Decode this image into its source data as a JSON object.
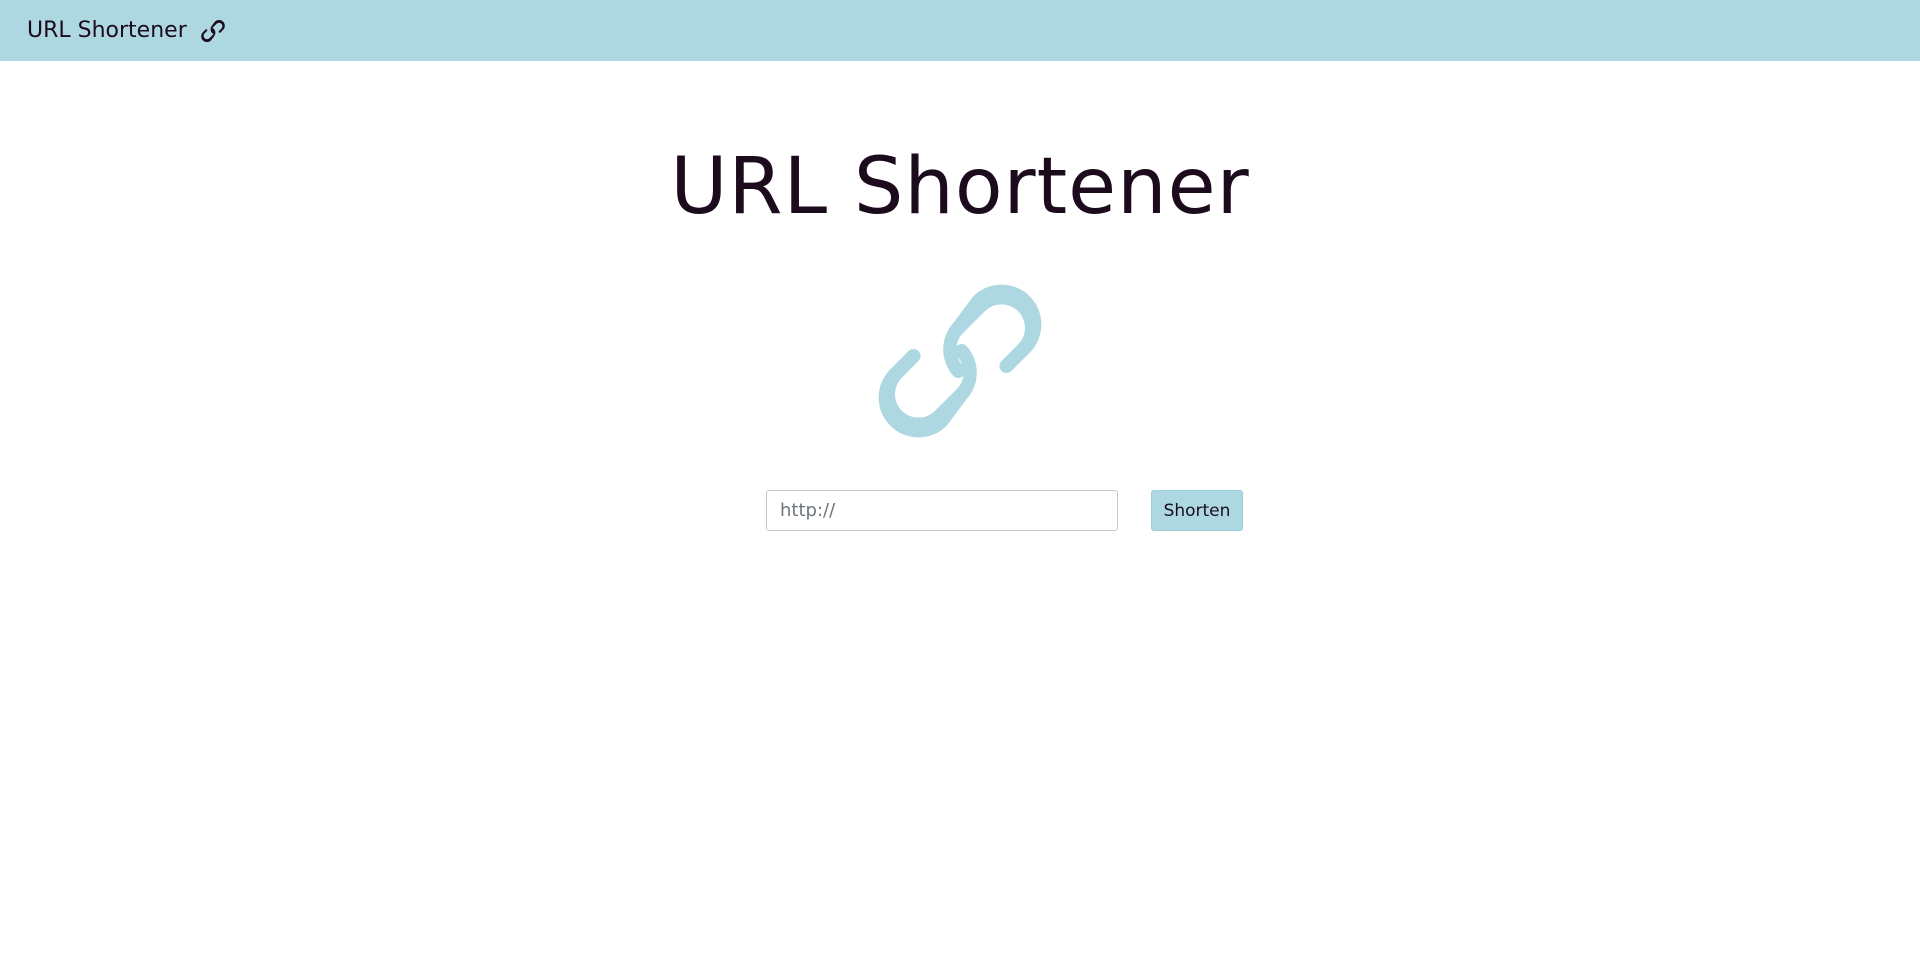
{
  "navbar": {
    "brand_label": "URL Shortener",
    "brand_icon": "link-icon",
    "background_color": "#add8e2"
  },
  "main": {
    "title": "URL Shortener",
    "hero_icon": "link-icon",
    "hero_icon_color": "#add8e2",
    "text_color": "#1b0b1c"
  },
  "form": {
    "url_placeholder": "http://",
    "url_value": "",
    "submit_label": "Shorten"
  }
}
